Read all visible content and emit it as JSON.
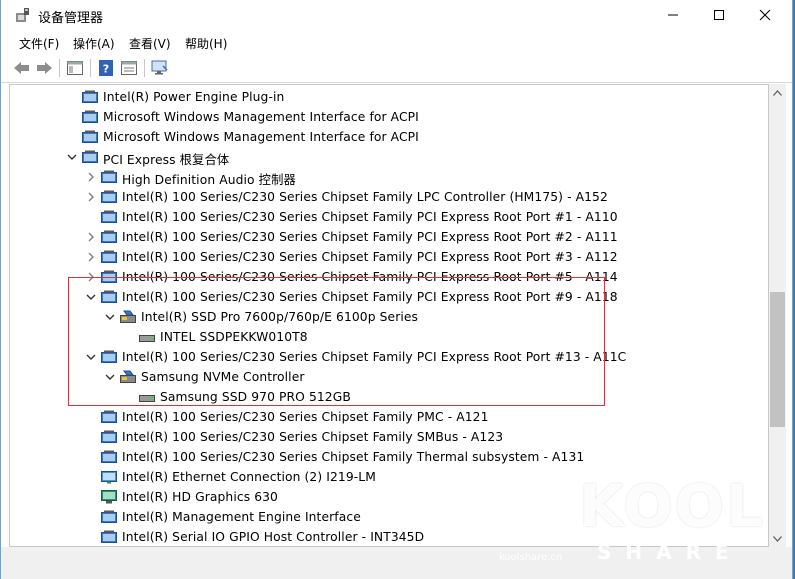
{
  "window": {
    "title": "设备管理器"
  },
  "menu": [
    "文件(F)",
    "操作(A)",
    "查看(V)",
    "帮助(H)"
  ],
  "tree": [
    {
      "label": "Intel(R) Power Engine Plug-in",
      "level": 1,
      "expand": "none",
      "icon": "device-icon"
    },
    {
      "label": "Microsoft Windows Management Interface for ACPI",
      "level": 1,
      "expand": "none",
      "icon": "device-icon"
    },
    {
      "label": "Microsoft Windows Management Interface for ACPI",
      "level": 1,
      "expand": "none",
      "icon": "device-icon"
    },
    {
      "label": "PCI Express 根复合体",
      "level": 1,
      "expand": "expanded",
      "icon": "device-icon"
    },
    {
      "label": "High Definition Audio 控制器",
      "level": 2,
      "expand": "collapsed",
      "icon": "device-icon"
    },
    {
      "label": "Intel(R) 100 Series/C230 Series Chipset Family LPC Controller (HM175) - A152",
      "level": 2,
      "expand": "collapsed",
      "icon": "device-icon"
    },
    {
      "label": "Intel(R) 100 Series/C230 Series Chipset Family PCI Express Root Port #1 - A110",
      "level": 2,
      "expand": "none",
      "icon": "device-icon"
    },
    {
      "label": "Intel(R) 100 Series/C230 Series Chipset Family PCI Express Root Port #2 - A111",
      "level": 2,
      "expand": "collapsed",
      "icon": "device-icon"
    },
    {
      "label": "Intel(R) 100 Series/C230 Series Chipset Family PCI Express Root Port #3 - A112",
      "level": 2,
      "expand": "collapsed",
      "icon": "device-icon"
    },
    {
      "label": "Intel(R) 100 Series/C230 Series Chipset Family PCI Express Root Port #5 - A114",
      "level": 2,
      "expand": "collapsed",
      "icon": "device-icon"
    },
    {
      "label": "Intel(R) 100 Series/C230 Series Chipset Family PCI Express Root Port #9 - A118",
      "level": 2,
      "expand": "expanded",
      "icon": "device-icon"
    },
    {
      "label": "Intel(R) SSD Pro 7600p/760p/E 6100p Series",
      "level": 3,
      "expand": "expanded",
      "icon": "storage-controller-icon"
    },
    {
      "label": "INTEL SSDPEKKW010T8",
      "level": 4,
      "expand": "none",
      "icon": "disk-drive-icon"
    },
    {
      "label": "Intel(R) 100 Series/C230 Series Chipset Family PCI Express Root Port #13 - A11C",
      "level": 2,
      "expand": "expanded",
      "icon": "device-icon"
    },
    {
      "label": "Samsung NVMe Controller",
      "level": 3,
      "expand": "expanded",
      "icon": "storage-controller-icon"
    },
    {
      "label": "Samsung SSD 970 PRO 512GB",
      "level": 4,
      "expand": "none",
      "icon": "disk-drive-icon"
    },
    {
      "label": "Intel(R) 100 Series/C230 Series Chipset Family PMC - A121",
      "level": 2,
      "expand": "none",
      "icon": "device-icon"
    },
    {
      "label": "Intel(R) 100 Series/C230 Series Chipset Family SMBus - A123",
      "level": 2,
      "expand": "none",
      "icon": "device-icon"
    },
    {
      "label": "Intel(R) 100 Series/C230 Series Chipset Family Thermal subsystem - A131",
      "level": 2,
      "expand": "none",
      "icon": "device-icon"
    },
    {
      "label": "Intel(R) Ethernet Connection (2) I219-LM",
      "level": 2,
      "expand": "none",
      "icon": "network-adapter-icon"
    },
    {
      "label": "Intel(R) HD Graphics 630",
      "level": 2,
      "expand": "none",
      "icon": "display-adapter-icon"
    },
    {
      "label": "Intel(R) Management Engine Interface",
      "level": 2,
      "expand": "none",
      "icon": "device-icon"
    },
    {
      "label": "Intel(R) Serial IO GPIO Host Controller - INT345D",
      "level": 2,
      "expand": "none",
      "icon": "device-icon"
    }
  ],
  "watermark": {
    "brand": "KOOL",
    "sub": "SHARE",
    "site": "koolshare.cn"
  },
  "colors": {
    "highlight": "#d0393f",
    "folder": "#3a78c2"
  }
}
